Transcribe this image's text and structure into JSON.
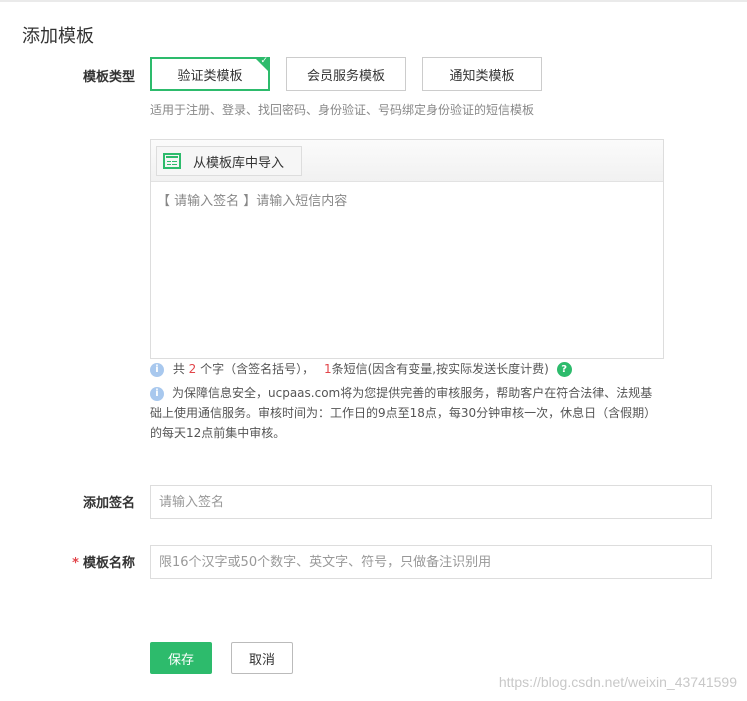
{
  "page": {
    "title": "添加模板"
  },
  "template_type": {
    "label": "模板类型",
    "options": [
      {
        "label": "验证类模板",
        "selected": true
      },
      {
        "label": "会员服务模板",
        "selected": false
      },
      {
        "label": "通知类模板",
        "selected": false
      }
    ],
    "hint": "适用于注册、登录、找回密码、身份验证、号码绑定身份验证的短信模板"
  },
  "editor": {
    "import_button": "从模板库中导入",
    "placeholder": "【 请输入签名 】请输入短信内容"
  },
  "counter": {
    "prefix": "共",
    "char_count": "2",
    "middle": "个字（含签名括号），",
    "sms_count": "1",
    "suffix": "条短信(因含有变量,按实际发送长度计费)"
  },
  "notice": "为保障信息安全，ucpaas.com将为您提供完善的审核服务，帮助客户在符合法律、法规基础上使用通信服务。审核时间为：工作日的9点至18点，每30分钟审核一次，休息日（含假期）的每天12点前集中审核。",
  "signature": {
    "label": "添加签名",
    "placeholder": "请输入签名",
    "value": ""
  },
  "template_name": {
    "required_mark": "*",
    "label": "模板名称",
    "placeholder": "限16个汉字或50个数字、英文字、符号，只做备注识别用",
    "value": ""
  },
  "actions": {
    "save": "保存",
    "cancel": "取消"
  },
  "watermark": "https://blog.csdn.net/weixin_43741599",
  "colors": {
    "accent": "#2dbb6c",
    "required": "#e2454a",
    "info": "#a8c8ee"
  },
  "icons": {
    "import": "table-icon",
    "info": "info-icon",
    "help": "question-icon",
    "selected_corner": "check-icon"
  }
}
